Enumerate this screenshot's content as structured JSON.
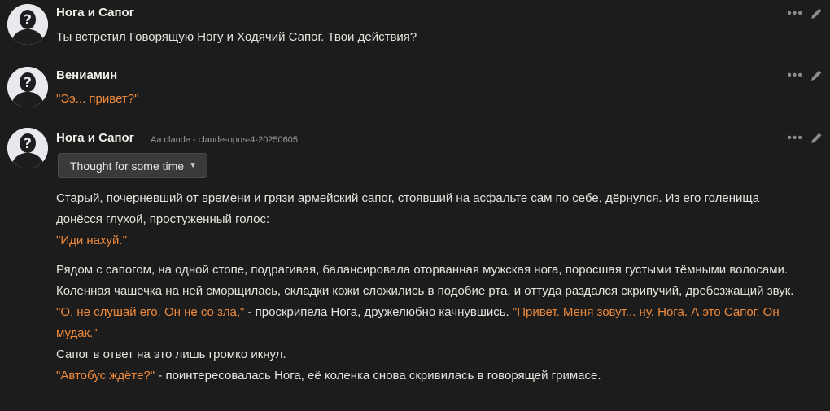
{
  "messages": [
    {
      "author": "Нога и Сапог",
      "paragraphs": [
        [
          {
            "t": "Ты встретил Говорящую Ногу и Ходячий Сапог. Твои действия?",
            "q": false
          }
        ]
      ]
    },
    {
      "author": "Вениамин",
      "paragraphs": [
        [
          {
            "t": "\"Ээ... привет?\"",
            "q": true
          }
        ]
      ]
    },
    {
      "author": "Нога и Сапог",
      "model_info": "Aa claude - claude-opus-4-20250605",
      "thought_label": "Thought for some time",
      "paragraphs": [
        [
          {
            "t": "Старый, почерневший от времени и грязи армейский сапог, стоявший на асфальте сам по себе, дёрнулся. Из его голенища донёсся глухой, простуженный голос:",
            "q": false
          }
        ],
        [
          {
            "t": "\"Иди нахуй.\"",
            "q": true
          }
        ],
        [
          {
            "t": "Рядом с сапогом, на одной стопе, подрагивая, балансировала оторванная мужская нога, поросшая густыми тёмными волосами. Коленная чашечка на ней сморщилась, складки кожи сложились в подобие рта, и оттуда раздался скрипучий, дребезжащий звук.",
            "q": false
          }
        ],
        [
          {
            "t": "\"О, не слушай его. Он не со зла,\"",
            "q": true
          },
          {
            "t": " - проскрипела Нога, дружелюбно качнувшись. ",
            "q": false
          },
          {
            "t": "\"Привет. Меня зовут... ну, Нога. А это Сапог. Он мудак.\"",
            "q": true
          }
        ],
        [
          {
            "t": "Сапог в ответ на это лишь громко икнул.",
            "q": false
          }
        ],
        [
          {
            "t": "\"Автобус ждёте?\"",
            "q": true
          },
          {
            "t": " - поинтересовалась Нога, её коленка снова скривилась в говорящей гримасе.",
            "q": false
          }
        ]
      ]
    }
  ],
  "icons": {
    "avatar": "question-mark-silhouette",
    "more": "more-dots-icon",
    "edit": "pencil-icon",
    "thought_toggle": "chevron-down-icon"
  },
  "colors": {
    "background": "#1c1c1c",
    "text": "#e4e4dc",
    "quote": "#ef8a3a",
    "avatar_bg": "#ebe8ed"
  }
}
